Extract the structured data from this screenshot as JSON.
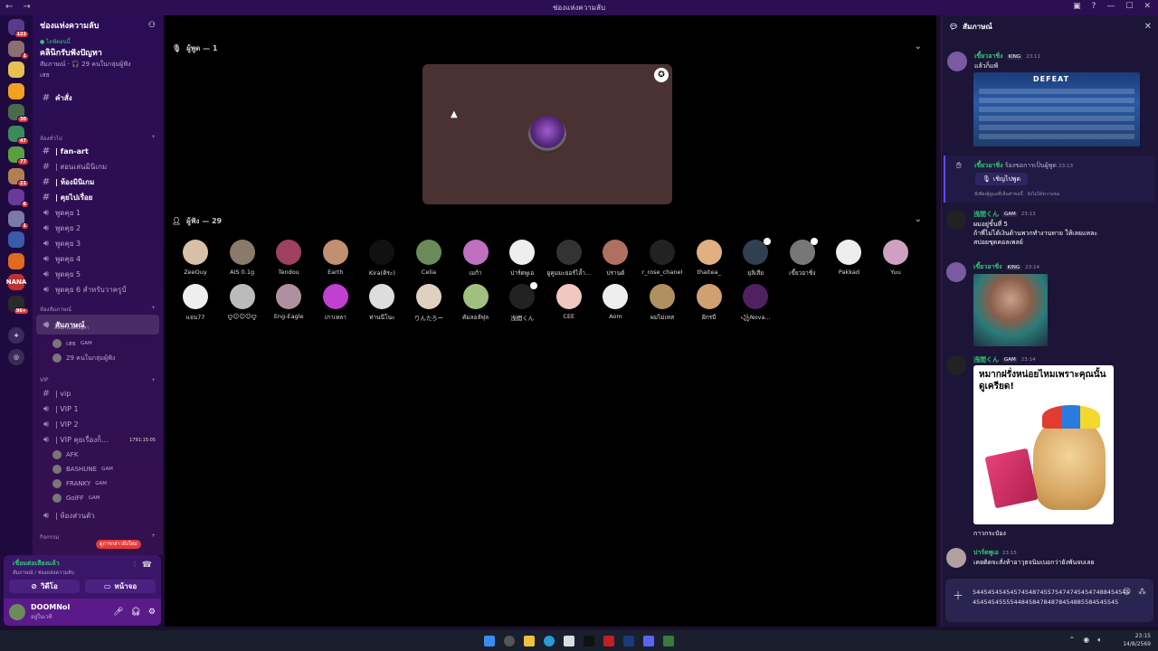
{
  "window": {
    "title": "ช่องแห่งความลับ",
    "nav_icons": "← →",
    "controls": [
      "▣",
      "?",
      "—",
      "☐",
      "✕"
    ]
  },
  "guilds": [
    {
      "badge": "122",
      "color": "#5a3a8a"
    },
    {
      "badge": "1",
      "color": "#8a7070"
    },
    {
      "badge": "",
      "color": "#e8c050"
    },
    {
      "badge": "",
      "color": "#f2a020"
    },
    {
      "badge": "30",
      "color": "#4a6a4a"
    },
    {
      "badge": "47",
      "color": "#3a8a5a"
    },
    {
      "badge": "77",
      "color": "#5aa040"
    },
    {
      "badge": "21",
      "color": "#b08050"
    },
    {
      "badge": "6",
      "color": "#6a3a9a"
    },
    {
      "badge": "1",
      "color": "#7a7aaa"
    },
    {
      "badge": "",
      "color": "#3a5aaa"
    },
    {
      "badge": "",
      "color": "#e06a20"
    },
    {
      "badge": "",
      "color": "#c03030",
      "label": "NANA"
    },
    {
      "badge": "96+",
      "color": "#2a2a2a"
    }
  ],
  "server": {
    "name": "ช่องแห่งความลับ",
    "event": {
      "tag": "● ไลฟ์ตอนนี้",
      "title": "คลินิกรับฟังปัญหา",
      "sub": "สัมภาษณ์ · 🎧 29 คนในกลุ่มผู้ฟัง",
      "who": "เสธ"
    },
    "channels_top": [
      {
        "name": "คำสั่ง",
        "bold": true
      }
    ],
    "cat_general": "ห้องทั่วไป",
    "channels_general": [
      {
        "name": "| fan-art",
        "bold": true
      },
      {
        "name": "| สอนเล่นมินิเกม",
        "bold": false
      },
      {
        "name": "| ห้องมินิเกม",
        "bold": true
      },
      {
        "name": "| คุยไปเรื่อย",
        "bold": true
      },
      {
        "name": "พูดคุย 1",
        "bold": false
      },
      {
        "name": "พูดคุย 2",
        "bold": false
      },
      {
        "name": "พูดคุย 3",
        "bold": false
      },
      {
        "name": "พูดคุย 4",
        "bold": false
      },
      {
        "name": "พูดคุย 5",
        "bold": false
      },
      {
        "name": "พูดคุย 6 สำหรับวาครูป์",
        "bold": false
      }
    ],
    "cat_interview": "ห้องสัมภาษณ์",
    "stage_channel": {
      "name": "สัมภาษณ์",
      "sub": "คลินิกรับฟังปัญหา"
    },
    "stage_members": [
      {
        "name": "เสธ",
        "tag": "GAM"
      },
      {
        "name": "29 คนในกลุ่มผู้ฟัง",
        "tag": ""
      }
    ],
    "cat_vip": "VIP",
    "channels_vip": [
      {
        "name": "| vip",
        "extra": ""
      },
      {
        "name": "| VIP 1",
        "extra": ""
      },
      {
        "name": "| VIP 2",
        "extra": ""
      },
      {
        "name": "| VIP คุยเรื่องก็...",
        "extra": "1791:15:05"
      }
    ],
    "vip_members": [
      {
        "name": "AFK",
        "tag": ""
      },
      {
        "name": "BASHUNE",
        "tag": "GAM"
      },
      {
        "name": "FRANKY",
        "tag": "GAM"
      },
      {
        "name": "GolFF",
        "tag": "GAM"
      }
    ],
    "channels_private": [
      {
        "name": "| ห้องส่วนตัว"
      }
    ],
    "cat_bottom": "กิจกรรม",
    "new_mentions": "ดูการกล่าวถึงใหม่"
  },
  "voice": {
    "status": "เชื่อมต่อเสียงแล้ว",
    "where": "สัมภาษณ์ / ช่องแห่งความลับ",
    "video_label": "วิดีโอ",
    "screen_label": "หน้าจอ"
  },
  "user": {
    "name": "DOOMNoI",
    "status": "อยู่ในเวที"
  },
  "stage": {
    "speakers_header": "ผู้พูด — 1",
    "audience_header": "ผู้ฟัง — 29",
    "audience": [
      {
        "name": "ZeeOuy",
        "color": "#d8c0a8"
      },
      {
        "name": "AIS 0.1g",
        "color": "#8a7a6a"
      },
      {
        "name": "Tendou",
        "color": "#a04060"
      },
      {
        "name": "Earth",
        "color": "#c09070"
      },
      {
        "name": "Kira(คิระ)",
        "color": "#111"
      },
      {
        "name": "Celia",
        "color": "#6a8a5a"
      },
      {
        "name": "เมก้า",
        "color": "#c070c0"
      },
      {
        "name": "ปาร์ดพูเอ",
        "color": "#eee"
      },
      {
        "name": "ยูคูมมะยอร์ไล้ำ...",
        "color": "#333"
      },
      {
        "name": "ปรานต์",
        "color": "#b07060"
      },
      {
        "name": "r_rose_chanel",
        "color": "#222"
      },
      {
        "name": "thaitea_",
        "color": "#e0b080"
      },
      {
        "name": "ยุลิเสีย",
        "color": "#304050"
      },
      {
        "name": "เขี้ยวอาชิ่ง",
        "color": "#777"
      },
      {
        "name": "Pakkad",
        "color": "#eee"
      },
      {
        "name": "Yuu",
        "color": "#d0a0c0"
      },
      {
        "name": "แจน77",
        "color": "#eee"
      },
      {
        "name": "ꨄ︎☺︎☺︎☺︎ꨄ︎",
        "color": "#bbb"
      },
      {
        "name": "Eng-Eagle",
        "color": "#b090a0"
      },
      {
        "name": "เกาเหลา",
        "color": "#c040d0"
      },
      {
        "name": "ท่านนีโนะ",
        "color": "#ddd"
      },
      {
        "name": "りんたろー",
        "color": "#e0d0c0"
      },
      {
        "name": "คัมลอส์ฟุล",
        "color": "#a0c080"
      },
      {
        "name": "浅間くん",
        "color": "#222"
      },
      {
        "name": "CEE",
        "color": "#f0c8c0"
      },
      {
        "name": "Aom",
        "color": "#eee"
      },
      {
        "name": "ผมไม่เทส",
        "color": "#b09060"
      },
      {
        "name": "ฝักรบี",
        "color": "#d0a070"
      },
      {
        "name": "꧁Nova...",
        "color": "#502060"
      }
    ]
  },
  "chat": {
    "title": "สัมภาษณ์",
    "messages": [
      {
        "name": "เขี้ยวอาชิ่ง",
        "tag": "KING",
        "time": "23:11",
        "text": "แล้วก็แพ้"
      },
      {
        "name": "เขี้ยวอาชิ่ง",
        "tag": "",
        "time": "23:13",
        "text": "ร้องขอการเป็นผู้พูด"
      },
      {
        "name": "浅間くん",
        "tag": "GAM",
        "time": "23:13",
        "text": "ผมอยู่ขั้นที่ 5\nถ้าพี่ไม่ได้เงินด้านพวกทำงานทาย ให้เลยแหละ\nสปอยชุดคอลเพลย์"
      },
      {
        "name": "เขี้ยวอาชิ่ง",
        "tag": "KING",
        "time": "23:14",
        "text": ""
      },
      {
        "name": "浅間くん",
        "tag": "GAM",
        "time": "23:14",
        "text": ""
      },
      {
        "name": "ปาร์ดพูเอ",
        "tag": "",
        "time": "23:15",
        "text": "เคยติดจะสั่งท้าอาวุธจนิมเบอกว่ายังพันจบเลย"
      }
    ],
    "defeat_text": "DEFEAT",
    "join_button": "เชิญไปพูด",
    "request_note": "มีเพียงผู้ดูแลที่เห็นคำขอนี้ · ยังไม่ได้ความขอ",
    "doge_caption": "หมากฝรั่งหน่อยไหมเพราะคุณนั้นดูเครียด!",
    "after_doge": "กาวกระป๋อง",
    "input_text": "544545454545745487455754747454547488454545454545455554484584784878454885584545545"
  },
  "tray": {
    "time": "23:15",
    "date": "14/8/2569"
  }
}
